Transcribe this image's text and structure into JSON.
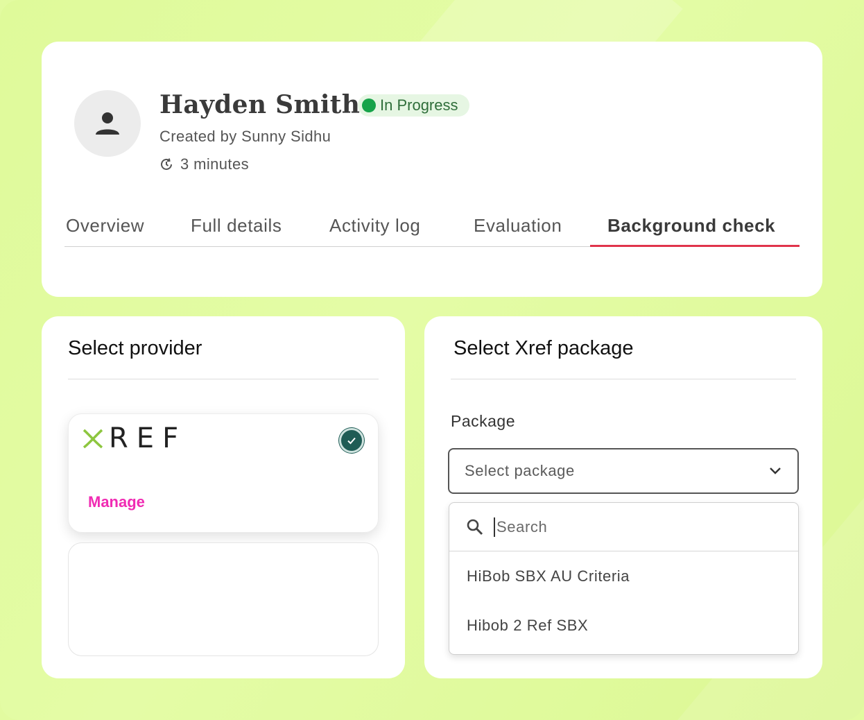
{
  "candidate": {
    "name": "Hayden Smith",
    "status": "In Progress",
    "created_by": "Created by Sunny Sidhu",
    "duration": "3 minutes"
  },
  "tabs": [
    {
      "label": "Overview"
    },
    {
      "label": "Full details"
    },
    {
      "label": "Activity log"
    },
    {
      "label": "Evaluation"
    },
    {
      "label": "Background check",
      "active": true
    }
  ],
  "provider_panel": {
    "title": "Select provider",
    "provider_name": "REF",
    "manage_label": "Manage"
  },
  "package_panel": {
    "title": "Select Xref package",
    "field_label": "Package",
    "select_placeholder": "Select package",
    "search_placeholder": "Search",
    "options": [
      {
        "label": "HiBob SBX AU Criteria"
      },
      {
        "label": "Hibob 2 Ref SBX"
      }
    ]
  },
  "colors": {
    "background": "#e2fba0",
    "status_dot": "#17a34a",
    "tab_underline": "#e0344b",
    "manage_link": "#f02bb3",
    "check_circle": "#1f5c55",
    "xref_mark": "#8dc63f"
  },
  "icons": {
    "avatar": "person-icon",
    "duration": "clock-icon",
    "selected": "check-circle-icon",
    "dropdown": "chevron-down-icon",
    "search": "search-icon"
  }
}
